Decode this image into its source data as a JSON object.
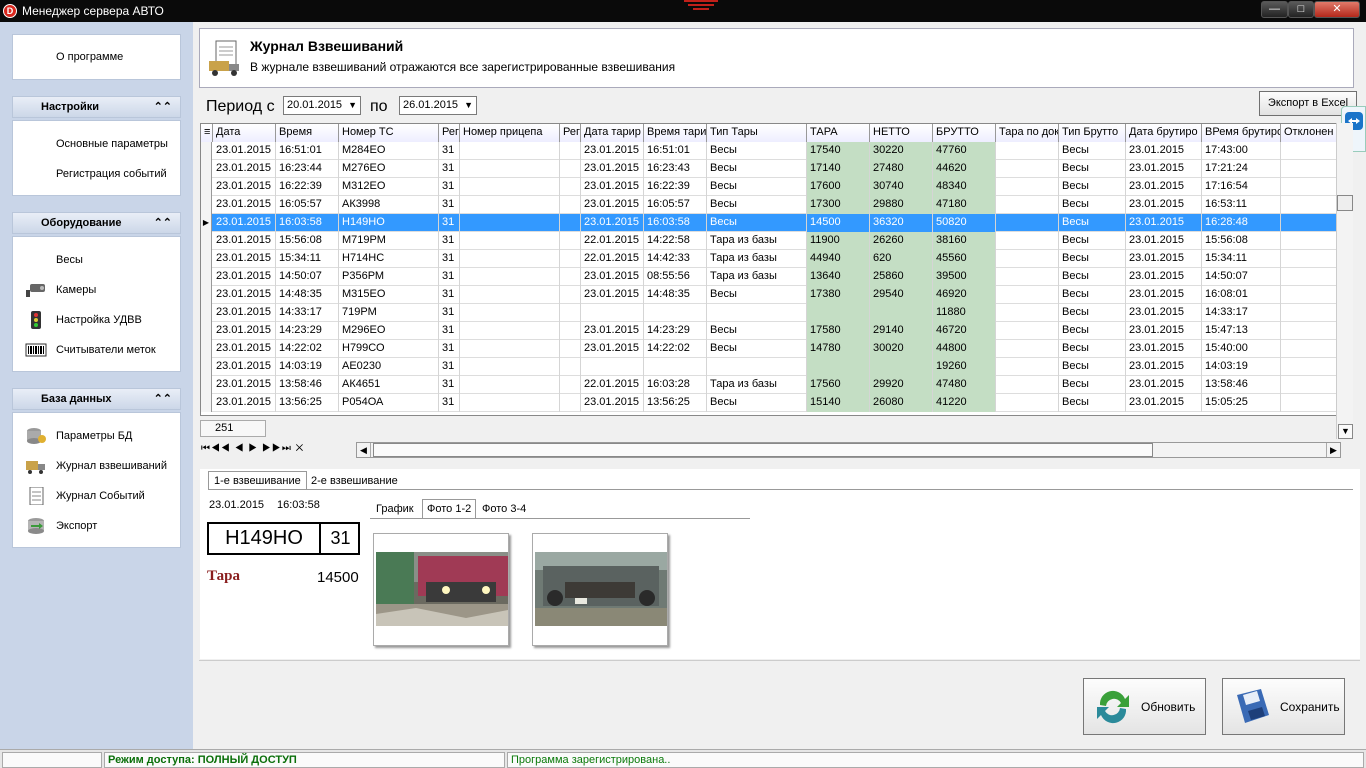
{
  "window": {
    "title": "Менеджер сервера АВТО",
    "min": "—",
    "max": "□",
    "close": "✕"
  },
  "sidebar": {
    "about": "О программе",
    "settings": {
      "title": "Настройки",
      "items": [
        "Основные параметры",
        "Регистрация событий"
      ]
    },
    "equipment": {
      "title": "Оборудование",
      "items": [
        {
          "label": "Весы",
          "icon": "scales-icon"
        },
        {
          "label": "Камеры",
          "icon": "camera-icon"
        },
        {
          "label": "Настройка УДВВ",
          "icon": "traffic-light-icon"
        },
        {
          "label": "Считыватели меток",
          "icon": "barcode-icon"
        }
      ]
    },
    "database": {
      "title": "База данных",
      "items": [
        {
          "label": "Параметры БД",
          "icon": "db-settings-icon"
        },
        {
          "label": "Журнал взвешиваний",
          "icon": "truck-journal-icon"
        },
        {
          "label": "Журнал Событий",
          "icon": "document-icon"
        },
        {
          "label": "Экспорт",
          "icon": "export-db-icon"
        }
      ]
    },
    "collapse_glyph": "«"
  },
  "header": {
    "title": "Журнал Взвешиваний",
    "subtitle": "В журнале взвешиваний отражаются все зарегистрированные взвешивания"
  },
  "period": {
    "from_label": "Период с",
    "to_label": "по",
    "from": "20.01.2015",
    "to": "26.01.2015"
  },
  "export_excel": "Экспорт в Excel",
  "grid": {
    "columns": [
      "Дата",
      "Время",
      "Номер ТС",
      "Рег",
      "Номер прицепа",
      "Рег",
      "Дата тарир",
      "Время тарир",
      "Тип Тары",
      "ТАРА",
      "НЕТТО",
      "БРУТТО",
      "Тара по док",
      "Тип Брутто",
      "Дата брутиро",
      "ВРемя брутиро",
      "Отклонен"
    ],
    "rows": [
      [
        "23.01.2015",
        "16:51:01",
        "М284ЕО",
        "31",
        "",
        "",
        "23.01.2015",
        "16:51:01",
        "Весы",
        "17540",
        "30220",
        "47760",
        "",
        "Весы",
        "23.01.2015",
        "17:43:00",
        ""
      ],
      [
        "23.01.2015",
        "16:23:44",
        "М276ЕО",
        "31",
        "",
        "",
        "23.01.2015",
        "16:23:43",
        "Весы",
        "17140",
        "27480",
        "44620",
        "",
        "Весы",
        "23.01.2015",
        "17:21:24",
        ""
      ],
      [
        "23.01.2015",
        "16:22:39",
        "М312ЕО",
        "31",
        "",
        "",
        "23.01.2015",
        "16:22:39",
        "Весы",
        "17600",
        "30740",
        "48340",
        "",
        "Весы",
        "23.01.2015",
        "17:16:54",
        ""
      ],
      [
        "23.01.2015",
        "16:05:57",
        "АК3998",
        "31",
        "",
        "",
        "23.01.2015",
        "16:05:57",
        "Весы",
        "17300",
        "29880",
        "47180",
        "",
        "Весы",
        "23.01.2015",
        "16:53:11",
        ""
      ],
      [
        "23.01.2015",
        "16:03:58",
        "Н149НО",
        "31",
        "",
        "",
        "23.01.2015",
        "16:03:58",
        "Весы",
        "14500",
        "36320",
        "50820",
        "",
        "Весы",
        "23.01.2015",
        "16:28:48",
        ""
      ],
      [
        "23.01.2015",
        "15:56:08",
        "М719РМ",
        "31",
        "",
        "",
        "22.01.2015",
        "14:22:58",
        "Тара из базы",
        "11900",
        "26260",
        "38160",
        "",
        "Весы",
        "23.01.2015",
        "15:56:08",
        ""
      ],
      [
        "23.01.2015",
        "15:34:11",
        "Н714НС",
        "31",
        "",
        "",
        "22.01.2015",
        "14:42:33",
        "Тара из базы",
        "44940",
        "620",
        "45560",
        "",
        "Весы",
        "23.01.2015",
        "15:34:11",
        ""
      ],
      [
        "23.01.2015",
        "14:50:07",
        "Р356РМ",
        "31",
        "",
        "",
        "23.01.2015",
        "08:55:56",
        "Тара из базы",
        "13640",
        "25860",
        "39500",
        "",
        "Весы",
        "23.01.2015",
        "14:50:07",
        ""
      ],
      [
        "23.01.2015",
        "14:48:35",
        "М315ЕО",
        "31",
        "",
        "",
        "23.01.2015",
        "14:48:35",
        "Весы",
        "17380",
        "29540",
        "46920",
        "",
        "Весы",
        "23.01.2015",
        "16:08:01",
        ""
      ],
      [
        "23.01.2015",
        "14:33:17",
        "719РМ",
        "31",
        "",
        "",
        "",
        "",
        "",
        "",
        "",
        "11880",
        "",
        "Весы",
        "23.01.2015",
        "14:33:17",
        ""
      ],
      [
        "23.01.2015",
        "14:23:29",
        "М296ЕО",
        "31",
        "",
        "",
        "23.01.2015",
        "14:23:29",
        "Весы",
        "17580",
        "29140",
        "46720",
        "",
        "Весы",
        "23.01.2015",
        "15:47:13",
        ""
      ],
      [
        "23.01.2015",
        "14:22:02",
        "Н799СО",
        "31",
        "",
        "",
        "23.01.2015",
        "14:22:02",
        "Весы",
        "14780",
        "30020",
        "44800",
        "",
        "Весы",
        "23.01.2015",
        "15:40:00",
        ""
      ],
      [
        "23.01.2015",
        "14:03:19",
        "АЕ0230",
        "31",
        "",
        "",
        "",
        "",
        "",
        "",
        "",
        "19260",
        "",
        "Весы",
        "23.01.2015",
        "14:03:19",
        ""
      ],
      [
        "23.01.2015",
        "13:58:46",
        "АК4651",
        "31",
        "",
        "",
        "22.01.2015",
        "16:03:28",
        "Тара из базы",
        "17560",
        "29920",
        "47480",
        "",
        "Весы",
        "23.01.2015",
        "13:58:46",
        ""
      ],
      [
        "23.01.2015",
        "13:56:25",
        "Р054ОА",
        "31",
        "",
        "",
        "23.01.2015",
        "13:56:25",
        "Весы",
        "15140",
        "26080",
        "41220",
        "",
        "Весы",
        "23.01.2015",
        "15:05:25",
        ""
      ]
    ],
    "selected_index": 4,
    "count": "251",
    "nav": "⏮◀◀ ◀ ▶ ▶▶⏭ ✕"
  },
  "detail": {
    "tabs": [
      "1-е взвешивание",
      "2-е взвешивание"
    ],
    "date": "23.01.2015",
    "time": "16:03:58",
    "plate": "Н149НО",
    "region": "31",
    "tara_label": "Тара",
    "tara_value": "14500",
    "photo_tabs": [
      "График",
      "Фото 1-2",
      "Фото 3-4"
    ]
  },
  "buttons": {
    "refresh": "Обновить",
    "save": "Сохранить"
  },
  "status": {
    "access": "Режим доступа: ПОЛНЫЙ ДОСТУП",
    "registered": "Программа зарегистрирована.."
  },
  "colors": {
    "selection": "#3399ff",
    "weight_cols": "#c4dec4",
    "sidebar_bg": "#c9d5e8",
    "status_green": "#0a6f0a"
  }
}
